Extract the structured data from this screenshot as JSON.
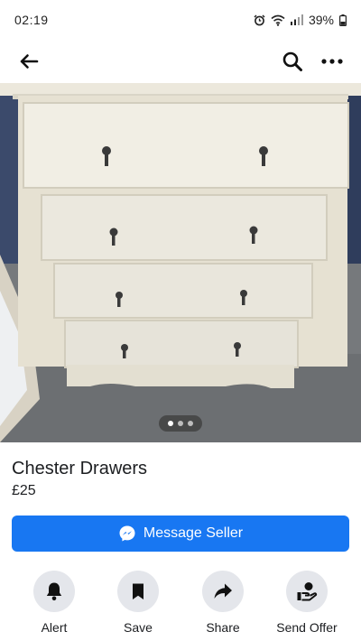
{
  "status_bar": {
    "time": "02:19",
    "battery": "39%",
    "icons": [
      "alarm-icon",
      "wifi-icon",
      "signal-icon",
      "battery-icon"
    ]
  },
  "top_bar": {
    "icons": [
      "back-arrow-icon",
      "search-icon",
      "more-options-icon"
    ]
  },
  "photo": {
    "page_count": 3,
    "active_page": 1
  },
  "listing": {
    "title": "Chester Drawers",
    "price": "£25"
  },
  "message_button": {
    "label": "Message Seller",
    "icon": "messenger-icon"
  },
  "actions": [
    {
      "label": "Alert",
      "icon": "bell-icon"
    },
    {
      "label": "Save",
      "icon": "bookmark-icon"
    },
    {
      "label": "Share",
      "icon": "share-arrow-icon"
    },
    {
      "label": "Send Offer",
      "icon": "offer-hand-icon"
    }
  ],
  "colors": {
    "accent": "#1877f2",
    "action_circle": "#e4e6eb",
    "text": "#1c1e21"
  }
}
